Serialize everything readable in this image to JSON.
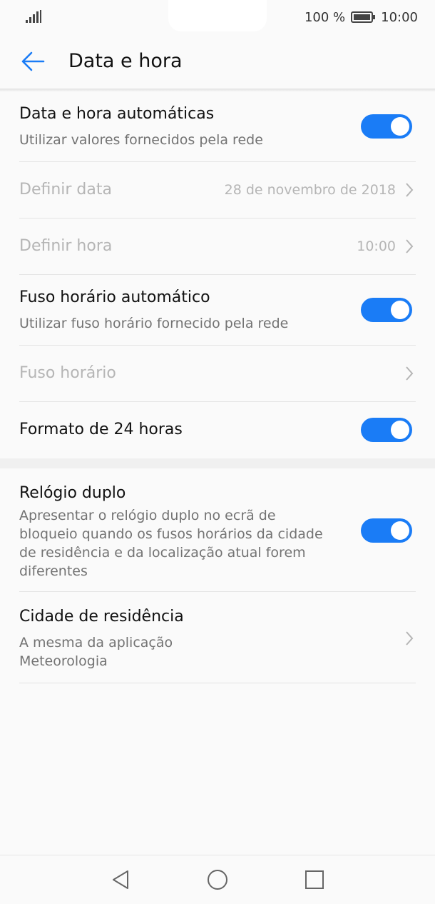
{
  "status_bar": {
    "battery_percent": "100 %",
    "time": "10:00",
    "icons": [
      "signal-icon",
      "battery-icon"
    ]
  },
  "app_bar": {
    "title": "Data e hora",
    "back_icon": "arrow-left-icon"
  },
  "settings": {
    "auto_datetime": {
      "title": "Data e hora automáticas",
      "subtitle": "Utilizar valores fornecidos pela rede",
      "enabled": true
    },
    "set_date": {
      "title": "Definir data",
      "value": "28 de novembro de 2018"
    },
    "set_time": {
      "title": "Definir hora",
      "value": "10:00"
    },
    "auto_timezone": {
      "title": "Fuso horário automático",
      "subtitle": "Utilizar fuso horário fornecido pela rede",
      "enabled": true
    },
    "timezone": {
      "title": "Fuso horário"
    },
    "format_24h": {
      "title": "Formato de 24 horas",
      "enabled": true
    },
    "dual_clock": {
      "title": "Relógio duplo",
      "subtitle_lines": [
        "Apresentar o relógio duplo no ecrã de",
        "bloqueio quando os fusos horários da cidade",
        "de residência e da localização atual forem",
        "diferentes"
      ],
      "enabled": true
    },
    "home_city": {
      "title": "Cidade de residência",
      "subtitle_lines": [
        "A mesma da aplicação",
        "Meteorologia"
      ]
    }
  },
  "colors": {
    "accent": "#1a7cf6",
    "disabled_text": "#b5b5b5",
    "secondary_text": "#737373"
  },
  "nav_bar": {
    "icons": [
      "back-triangle-icon",
      "home-circle-icon",
      "recents-square-icon"
    ]
  }
}
